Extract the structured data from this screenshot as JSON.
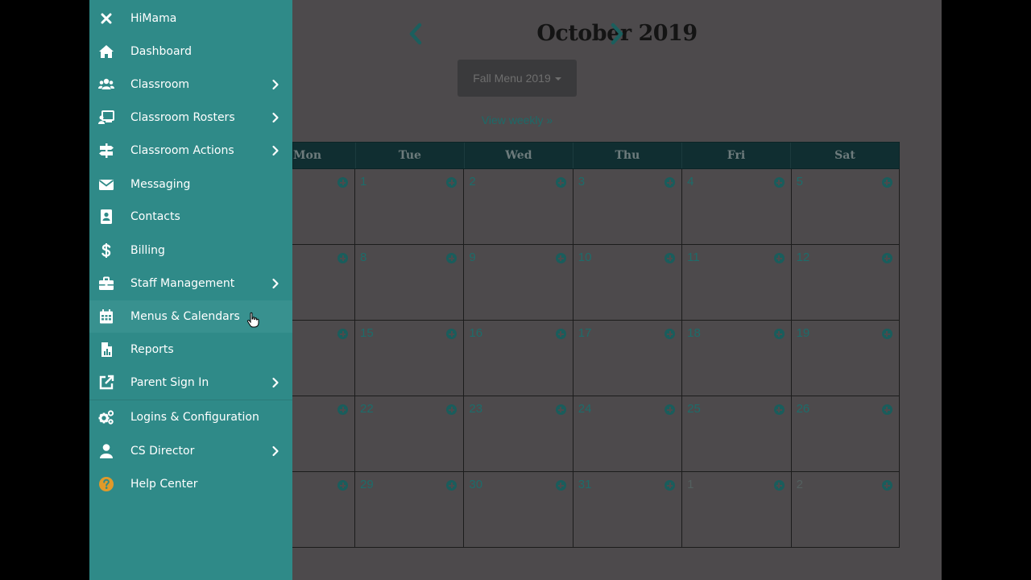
{
  "sidebar": {
    "close_label": "HiMama",
    "items": [
      {
        "label": "Dashboard",
        "icon": "home-icon"
      },
      {
        "label": "Classroom",
        "icon": "users-icon",
        "chevron": true
      },
      {
        "label": "Classroom Rosters",
        "icon": "roster-icon",
        "chevron": true
      },
      {
        "label": "Classroom Actions",
        "icon": "signpost-icon",
        "chevron": true
      },
      {
        "label": "Messaging",
        "icon": "envelope-icon"
      },
      {
        "label": "Contacts",
        "icon": "address-book-icon"
      },
      {
        "label": "Billing",
        "icon": "dollar-icon"
      },
      {
        "label": "Staff Management",
        "icon": "briefcase-icon",
        "chevron": true
      },
      {
        "label": "Menus & Calendars",
        "icon": "calendar-icon",
        "active": true
      },
      {
        "label": "Reports",
        "icon": "report-icon"
      },
      {
        "label": "Parent Sign In",
        "icon": "external-link-icon",
        "chevron": true
      },
      {
        "label": "Logins & Configuration",
        "icon": "gears-icon"
      },
      {
        "label": "CS Director",
        "icon": "user-icon",
        "chevron": true
      },
      {
        "label": "Help Center",
        "icon": "help-icon"
      }
    ]
  },
  "calendar": {
    "month_title": "October 2019",
    "menu_select": "Fall Menu 2019",
    "view_weekly": "View weekly »",
    "weekdays": [
      "Mon",
      "Tue",
      "Wed",
      "Thu",
      "Fri",
      "Sat"
    ],
    "weeks": [
      [
        "",
        "1",
        "2",
        "3",
        "4",
        "5"
      ],
      [
        "",
        "8",
        "9",
        "10",
        "11",
        "12"
      ],
      [
        "",
        "15",
        "16",
        "17",
        "18",
        "19"
      ],
      [
        "",
        "22",
        "23",
        "24",
        "25",
        "26"
      ],
      [
        "",
        "29",
        "30",
        "31",
        "1",
        "2"
      ]
    ],
    "outside_month": [
      [
        4,
        4
      ],
      [
        4,
        5
      ]
    ]
  },
  "colors": {
    "sidebar_bg": "#2f8a88",
    "overlay_bg": "#4d4a4c",
    "accent": "#1d6c6a",
    "header_bg": "#102e31",
    "help_icon": "#e09a2a"
  }
}
